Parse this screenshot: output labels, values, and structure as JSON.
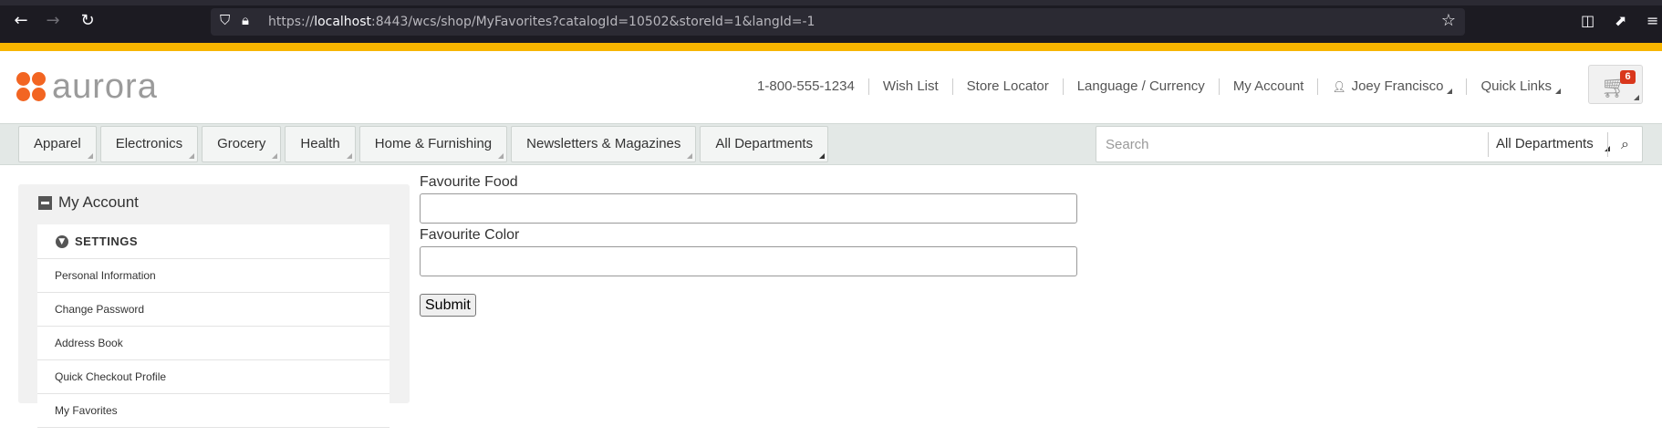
{
  "browser": {
    "back_icon": "arrow-left",
    "forward_icon": "arrow-right",
    "reload_icon": "reload",
    "url_prefix": "https://",
    "url_host": "localhost",
    "url_rest": ":8443/wcs/shop/MyFavorites?catalogId=10502&storeId=1&langId=-1"
  },
  "colors": {
    "accent": "#f7b500",
    "brand": "#f26522",
    "badge": "#d9371c"
  },
  "header": {
    "logo_text": "aurora",
    "phone": "1-800-555-1234",
    "wish_list": "Wish List",
    "store_locator": "Store Locator",
    "language_currency": "Language / Currency",
    "my_account": "My Account",
    "user_name": "Joey Francisco",
    "quick_links": "Quick Links",
    "cart_count": "6"
  },
  "departments": [
    "Apparel",
    "Electronics",
    "Grocery",
    "Health",
    "Home & Furnishing",
    "Newsletters & Magazines",
    "All Departments"
  ],
  "search": {
    "placeholder": "Search",
    "scope": "All Departments"
  },
  "sidebar": {
    "title": "My Account",
    "section": "SETTINGS",
    "items": [
      "Personal Information",
      "Change Password",
      "Address Book",
      "Quick Checkout Profile",
      "My Favorites"
    ]
  },
  "form": {
    "food_label": "Favourite Food",
    "food_value": "",
    "color_label": "Favourite Color",
    "color_value": "",
    "submit_label": "Submit"
  }
}
